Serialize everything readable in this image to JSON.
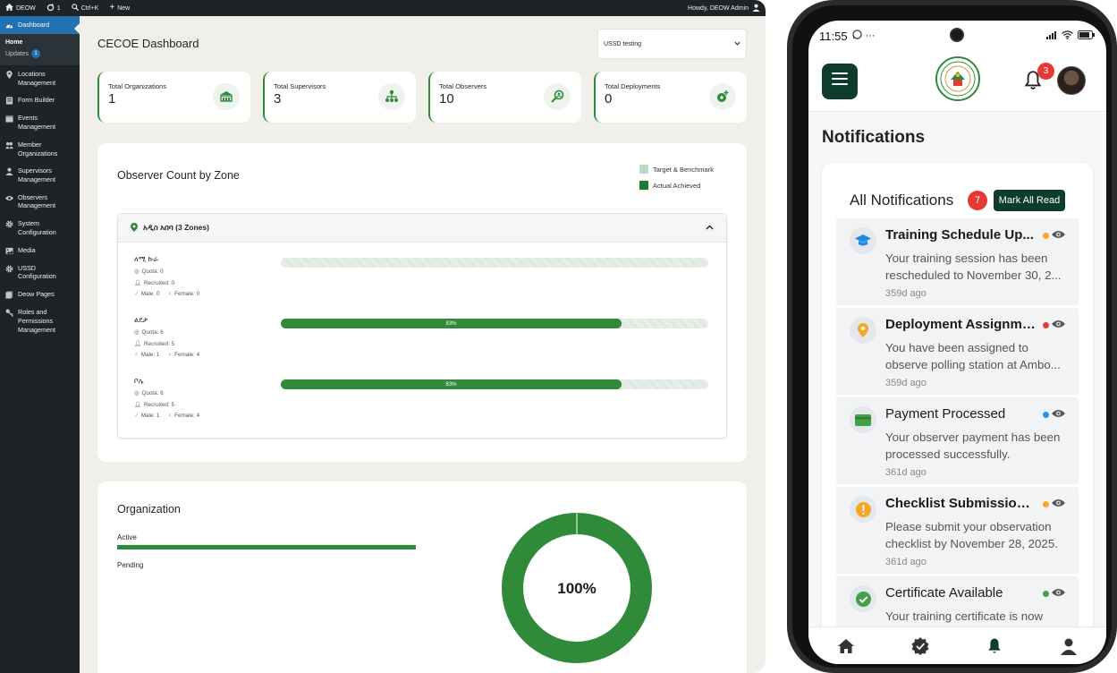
{
  "admin_bar": {
    "site_name": "DEOW",
    "comments_count": "1",
    "search_shortcut": "Ctrl+K",
    "new_label": "New",
    "howdy": "Howdy, DEOW Admin"
  },
  "sidebar": {
    "active": "Dashboard",
    "dashboard_label": "Dashboard",
    "submenu": {
      "home": "Home",
      "updates": "Updates",
      "updates_count": "1"
    },
    "items": [
      {
        "label": "Locations Management",
        "icon": "map-icon"
      },
      {
        "label": "Form Builder",
        "icon": "form-icon"
      },
      {
        "label": "Events Management",
        "icon": "calendar-icon"
      },
      {
        "label": "Member Organizations",
        "icon": "group-icon"
      },
      {
        "label": "Supervisors Management",
        "icon": "user-tie-icon"
      },
      {
        "label": "Observers Management",
        "icon": "eye-icon"
      },
      {
        "label": "System Configuration",
        "icon": "gear-icon"
      },
      {
        "label": "Media",
        "icon": "media-icon"
      },
      {
        "label": "USSD Configuration",
        "icon": "gear-icon"
      },
      {
        "label": "Deow Pages",
        "icon": "pages-icon"
      },
      {
        "label": "Roles and Permissions Management",
        "icon": "key-icon"
      }
    ]
  },
  "dashboard": {
    "title": "CECOE Dashboard",
    "ussd_select": "USSD testing",
    "stats": [
      {
        "label": "Total Organizations",
        "value": "1",
        "icon": "organization-icon"
      },
      {
        "label": "Total Supervisors",
        "value": "3",
        "icon": "hierarchy-icon"
      },
      {
        "label": "Total Observers",
        "value": "10",
        "icon": "observer-search-icon"
      },
      {
        "label": "Total Deployments",
        "value": "0",
        "icon": "deployment-icon"
      }
    ],
    "zone_panel": {
      "title": "Observer Count by Zone",
      "legend": {
        "target": "Target & Benchmark",
        "achieved": "Actual Achieved"
      },
      "accordion_title": "አዲስ አበባ (3 Zones)",
      "zones": [
        {
          "name": "ለሚ ኩራ",
          "quota": "Quota: 0",
          "recruited": "Recruited: 0",
          "male": "Male: 0",
          "female": "Female: 0",
          "percent": 0,
          "percent_label": ""
        },
        {
          "name": "ልደታ",
          "quota": "Quota: 6",
          "recruited": "Recruited: 5",
          "male": "Male: 1",
          "female": "Female: 4",
          "percent": 83,
          "percent_label": "83%"
        },
        {
          "name": "ቦሌ",
          "quota": "Quota: 6",
          "recruited": "Recruited: 5",
          "male": "Male: 1",
          "female": "Female: 4",
          "percent": 83,
          "percent_label": "83%"
        }
      ]
    },
    "org_panel": {
      "title": "Organization",
      "active_label": "Active",
      "pending_label": "Pending",
      "active_fraction": 1.0,
      "donut_label": "100%"
    }
  },
  "phone": {
    "time": "11:55",
    "bell_count": "3",
    "heading": "Notifications",
    "all_label": "All Notifications",
    "all_count": "7",
    "mark_all": "Mark All Read",
    "notifications": [
      {
        "title": "Training Schedule Up...",
        "body": "Your training session has been rescheduled to November 30, 2...",
        "time": "359d ago",
        "unread": true,
        "icon": "graduation-cap-icon",
        "dot": "#f5a623"
      },
      {
        "title": "Deployment Assignme...",
        "body": "You have been assigned to observe polling station at Ambo...",
        "time": "359d ago",
        "unread": true,
        "icon": "location-pin-icon",
        "dot": "#e53935"
      },
      {
        "title": "Payment Processed",
        "body": "Your observer payment has been processed successfully.",
        "time": "361d ago",
        "unread": false,
        "icon": "payment-card-icon",
        "dot": "#2196f3"
      },
      {
        "title": "Checklist Submission ...",
        "body": "Please submit your observation checklist by November 28, 2025.",
        "time": "361d ago",
        "unread": true,
        "icon": "warning-icon",
        "dot": "#f5a623"
      },
      {
        "title": "Certificate Available",
        "body": "Your training certificate is now",
        "time": "",
        "unread": false,
        "icon": "check-circle-icon",
        "dot": "#43a047"
      }
    ],
    "bottom_nav": [
      "home-icon",
      "verified-icon",
      "bell-icon",
      "profile-icon"
    ]
  },
  "colors": {
    "accent_green": "#2f8a3a",
    "dark_green": "#0d3d2a",
    "admin_dark": "#1d2327",
    "admin_blue": "#2271b1"
  }
}
